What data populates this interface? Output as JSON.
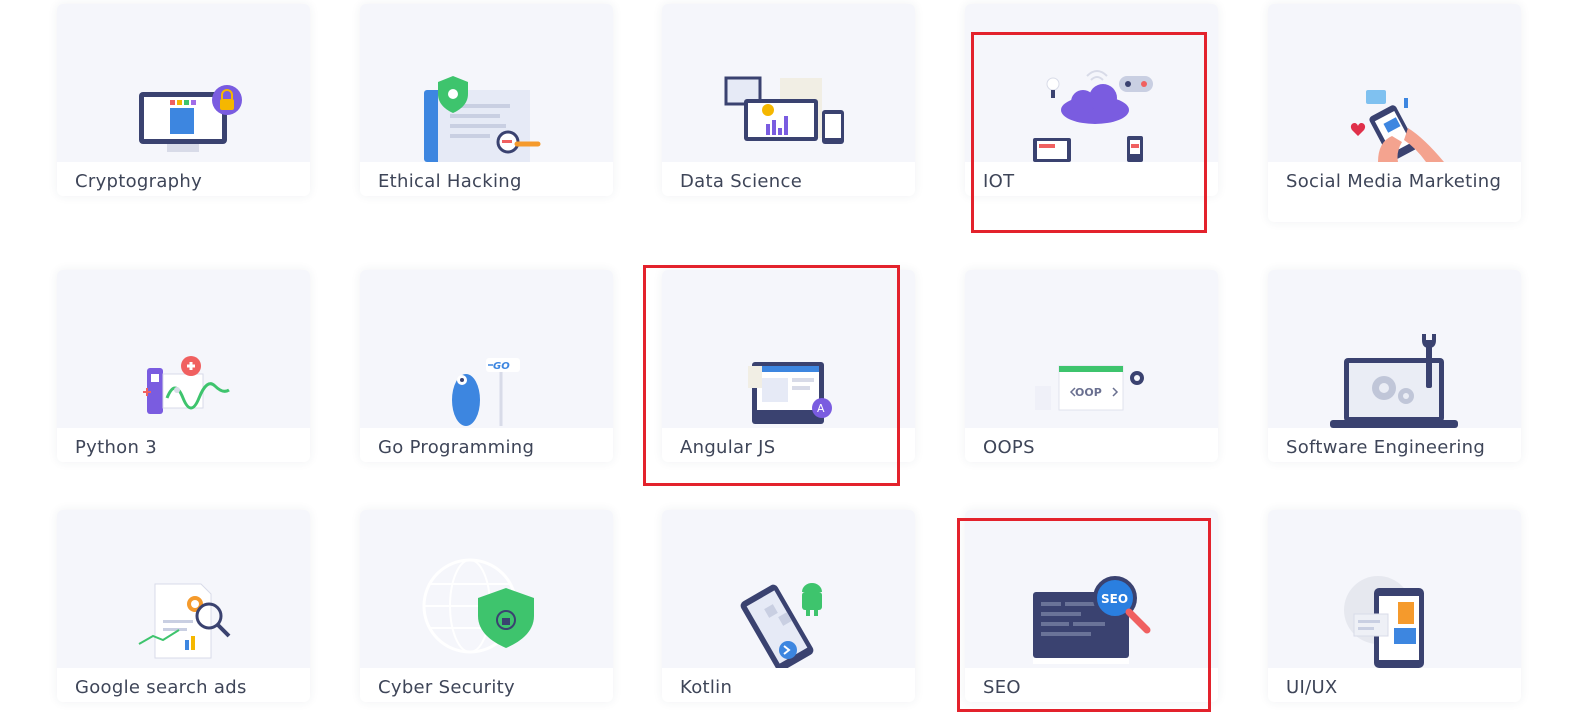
{
  "courses": [
    {
      "title": "Cryptography",
      "icon": "cryptography-illustration-icon"
    },
    {
      "title": "Ethical Hacking",
      "icon": "ethical-hacking-illustration-icon"
    },
    {
      "title": "Data Science",
      "icon": "data-science-illustration-icon"
    },
    {
      "title": "IOT",
      "icon": "iot-cloud-illustration-icon"
    },
    {
      "title": "Social Media Marketing",
      "icon": "social-media-phone-illustration-icon"
    },
    {
      "title": "Python 3",
      "icon": "python-illustration-icon"
    },
    {
      "title": "Go Programming",
      "icon": "go-gopher-illustration-icon"
    },
    {
      "title": "Angular JS",
      "icon": "angular-monitor-illustration-icon"
    },
    {
      "title": "OOPS",
      "icon": "oop-window-illustration-icon"
    },
    {
      "title": "Software Engineering",
      "icon": "laptop-gears-illustration-icon"
    },
    {
      "title": "Google search ads",
      "icon": "search-ads-document-illustration-icon"
    },
    {
      "title": "Cyber Security",
      "icon": "globe-shield-illustration-icon"
    },
    {
      "title": "Kotlin",
      "icon": "kotlin-phone-illustration-icon"
    },
    {
      "title": "SEO",
      "icon": "seo-magnifier-illustration-icon"
    },
    {
      "title": "UI/UX",
      "icon": "phone-layout-illustration-icon"
    }
  ],
  "highlighted_courses": [
    "IOT",
    "Angular JS",
    "SEO"
  ],
  "colors": {
    "highlight": "#e3222c",
    "card_bg": "#f5f6fb",
    "label_text": "#3e4558"
  }
}
